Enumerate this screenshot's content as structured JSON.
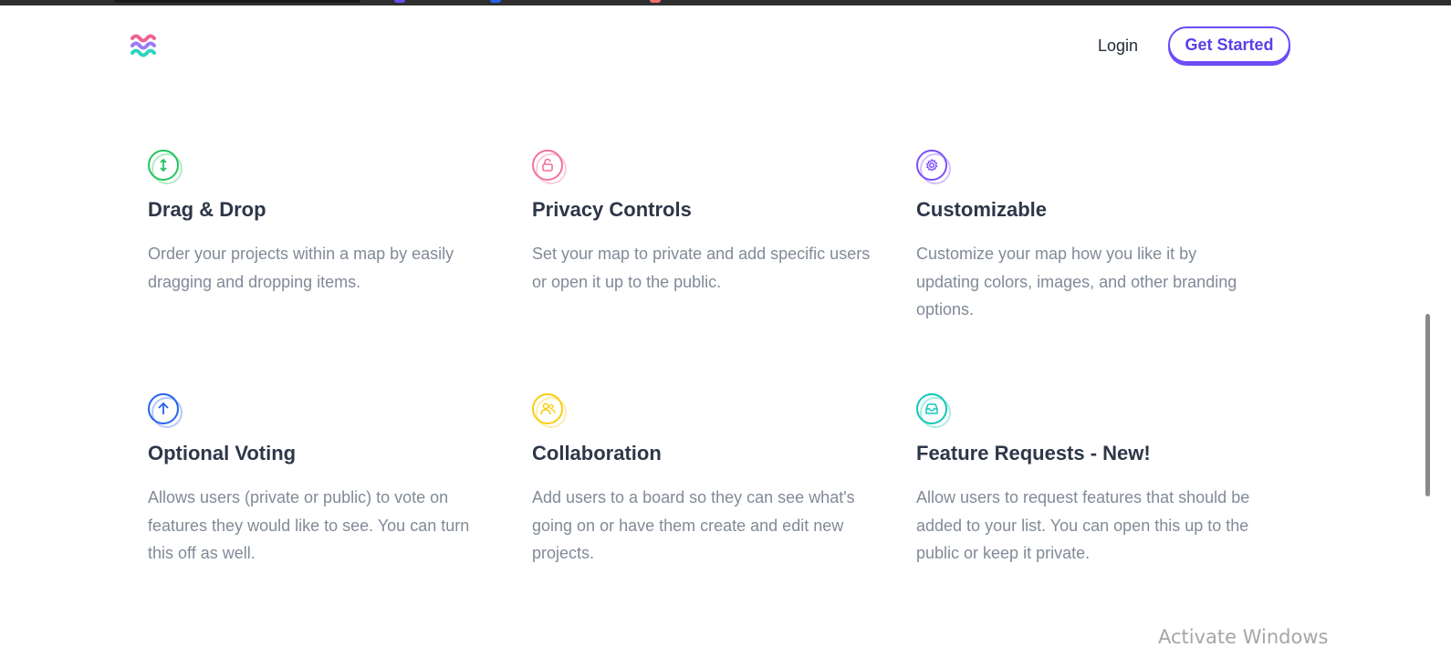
{
  "header": {
    "logo_name": "wave-logo",
    "login_label": "Login",
    "cta_label": "Get Started"
  },
  "colors": {
    "accent": "#6d4cf6",
    "heading": "#2d3748",
    "body_text": "#818a97",
    "drag_drop": "#22c55e",
    "privacy": "#f4729a",
    "customizable": "#7c4dff",
    "voting": "#2563eb",
    "collaboration": "#facc15",
    "feature_requests": "#14c7b8"
  },
  "features": [
    {
      "icon": "arrows-vertical-icon",
      "title": "Drag & Drop",
      "description": "Order your projects within a map by easily dragging and dropping items."
    },
    {
      "icon": "lock-open-icon",
      "title": "Privacy Controls",
      "description": "Set your map to private and add specific users or open it up to the public."
    },
    {
      "icon": "gear-icon",
      "title": "Customizable",
      "description": "Customize your map how you like it by updating colors, images, and other branding options."
    },
    {
      "icon": "arrow-up-icon",
      "title": "Optional Voting",
      "description": "Allows users (private or public) to vote on features they would like to see. You can turn this off as well."
    },
    {
      "icon": "users-icon",
      "title": "Collaboration",
      "description": "Add users to a board so they can see what's going on or have them create and edit new projects."
    },
    {
      "icon": "inbox-icon",
      "title": "Feature Requests - New!",
      "description": "Allow users to request features that should be added to your list. You can open this up to the public or keep it private."
    }
  ],
  "watermark": {
    "text": "Activate Windows"
  }
}
